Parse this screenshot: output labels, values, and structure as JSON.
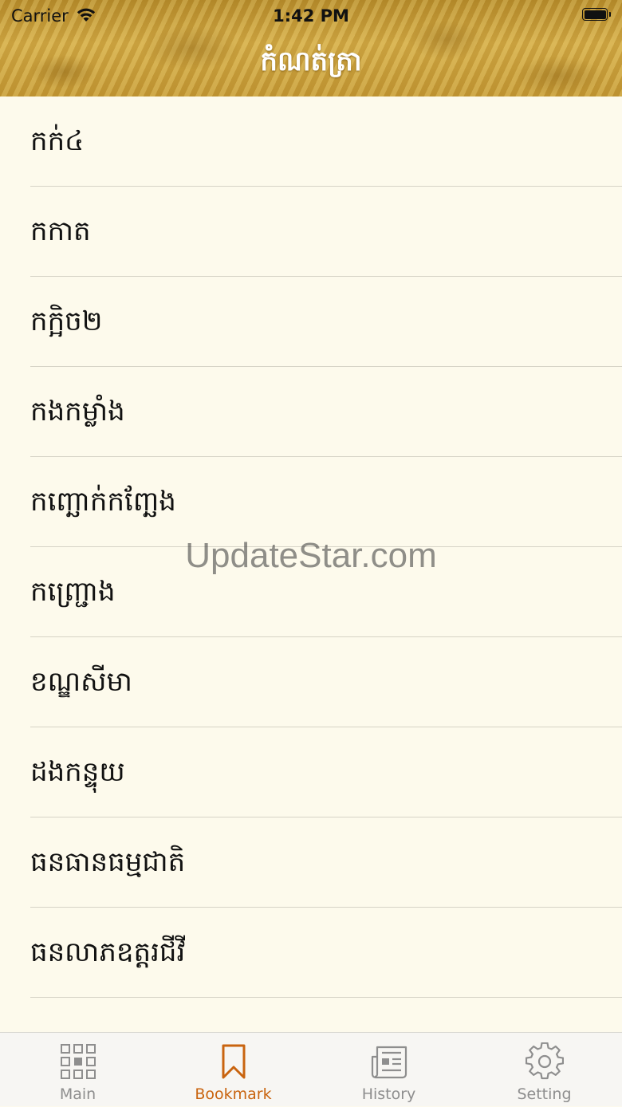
{
  "status_bar": {
    "carrier": "Carrier",
    "time": "1:42 PM"
  },
  "header": {
    "title": "កំណត់ត្រា"
  },
  "list": {
    "items": [
      "កក់៤",
      "កកាត",
      "កក្អិច២",
      "កងកម្លាំង",
      "កញ្ឆោក់កញ្ឆែង",
      "កញ្ជ្រោង",
      "ខណ្ឌសីមា",
      "ដងកន្ទុយ",
      "ធនធានធម្មជាតិ",
      "ធនលាភឧត្តរជីវី"
    ]
  },
  "watermark": "UpdateStar.com",
  "tabbar": {
    "active_color": "#c9640f",
    "inactive_color": "#8e8e8e",
    "tabs": [
      {
        "label": "Main",
        "icon": "grid-icon",
        "active": false
      },
      {
        "label": "Bookmark",
        "icon": "bookmark-icon",
        "active": true
      },
      {
        "label": "History",
        "icon": "newspaper-icon",
        "active": false
      },
      {
        "label": "Setting",
        "icon": "gear-icon",
        "active": false
      }
    ]
  }
}
